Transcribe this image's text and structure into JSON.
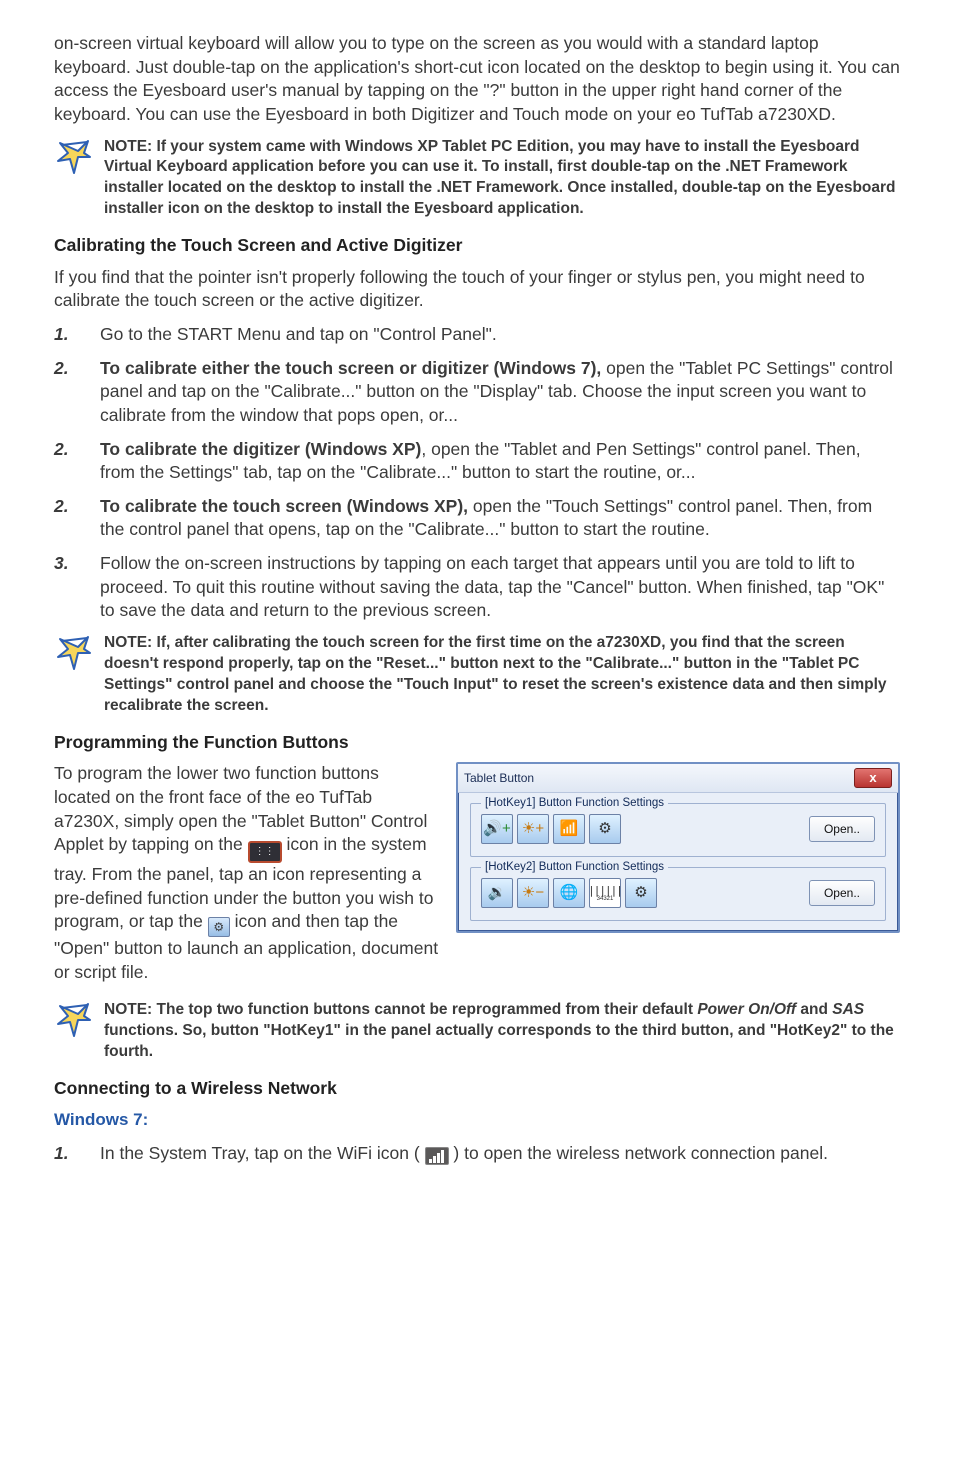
{
  "intro": "on-screen virtual keyboard will allow you to type on the screen as you would with a standard laptop keyboard. Just double-tap on the application's short-cut icon located on the desktop to begin using it. You can access the Eyesboard user's manual by tapping on the \"?\" button in the upper right hand corner of the keyboard. You can use the Eyesboard in both Digitizer and Touch mode on your eo TufTab a7230XD.",
  "note1": "NOTE: If your system came with Windows XP Tablet PC Edition, you may have to install the Eyesboard Virtual Keyboard application before you can use it. To install, first double-tap on the .NET Framework installer located on the desktop to install the .NET Framework. Once installed, double-tap on the Eyesboard installer icon on the desktop to install the Eyesboard application.",
  "heading_calibrate": "Calibrating the Touch Screen and Active Digitizer",
  "calibrate_intro": "If you find that the pointer isn't properly following the touch of your finger or stylus pen, you might need to calibrate the touch screen or the active digitizer.",
  "steps": [
    {
      "num": "1.",
      "lead": "",
      "body": "Go to the START Menu and tap on \"Control Panel\"."
    },
    {
      "num": "2.",
      "lead": "To calibrate either the touch screen or digitizer (Windows 7),",
      "body": " open the \"Tablet PC Settings\" control panel and tap on the \"Calibrate...\" button on the \"Display\" tab. Choose the input screen you want to calibrate from the window that pops open, or..."
    },
    {
      "num": "2.",
      "lead": "To calibrate the digitizer (Windows XP)",
      "body": ", open the \"Tablet and Pen Settings\" control panel. Then, from the Settings\" tab, tap on the \"Calibrate...\" button to start the routine, or..."
    },
    {
      "num": "2.",
      "lead": "To calibrate the touch screen (Windows XP),",
      "body": " open the \"Touch Settings\" control panel. Then, from the control panel that opens, tap on the \"Calibrate...\" button to start the routine."
    },
    {
      "num": "3.",
      "lead": "",
      "body": "Follow the on-screen instructions by tapping on each target that appears until you are told to lift to proceed. To quit this routine without saving the data, tap the \"Cancel\" button. When finished, tap \"OK\" to save the data and return to the previous screen."
    }
  ],
  "note2": "NOTE: If, after calibrating the touch screen for the first time on the a7230XD, you find that the screen doesn't respond properly, tap on the \"Reset...\" button next to the \"Calibrate...\" button in the \"Tablet PC Settings\" control panel and choose the \"Touch Input\" to reset the screen's existence data and then simply recalibrate the screen.",
  "heading_program": "Programming the Function Buttons",
  "program_text_1": "To program the lower two function buttons located on the front face of the eo TufTab a7230X, simply open the \"Tablet Button\" Control Applet by tapping on the ",
  "program_text_2": " icon in the system tray. From the panel, tap an icon representing a pre-defined function under the button you wish to program, or tap the ",
  "program_text_3": " icon and then tap the \"Open\" button to launch an application, document or script file.",
  "tablet_panel": {
    "title": "Tablet Button",
    "close": "x",
    "group1": "[HotKey1] Button Function Settings",
    "group2": "[HotKey2] Button Function Settings",
    "open": "Open..",
    "barcode_sub": "34321"
  },
  "note3_a": "NOTE: The top two function buttons cannot be reprogrammed from their default ",
  "note3_b": "Power On/Off",
  "note3_c": " and ",
  "note3_d": "SAS",
  "note3_e": " functions. So, button \"HotKey1\" in the panel actually corresponds to the third button, and \"HotKey2\" to the fourth.",
  "heading_wireless": "Connecting to a Wireless Network",
  "win7_label": "Windows 7:",
  "wireless_step_num": "1.",
  "wireless_step_a": "In the System Tray, tap on the WiFi icon (",
  "wireless_step_b": ") to open the wireless network connection panel."
}
